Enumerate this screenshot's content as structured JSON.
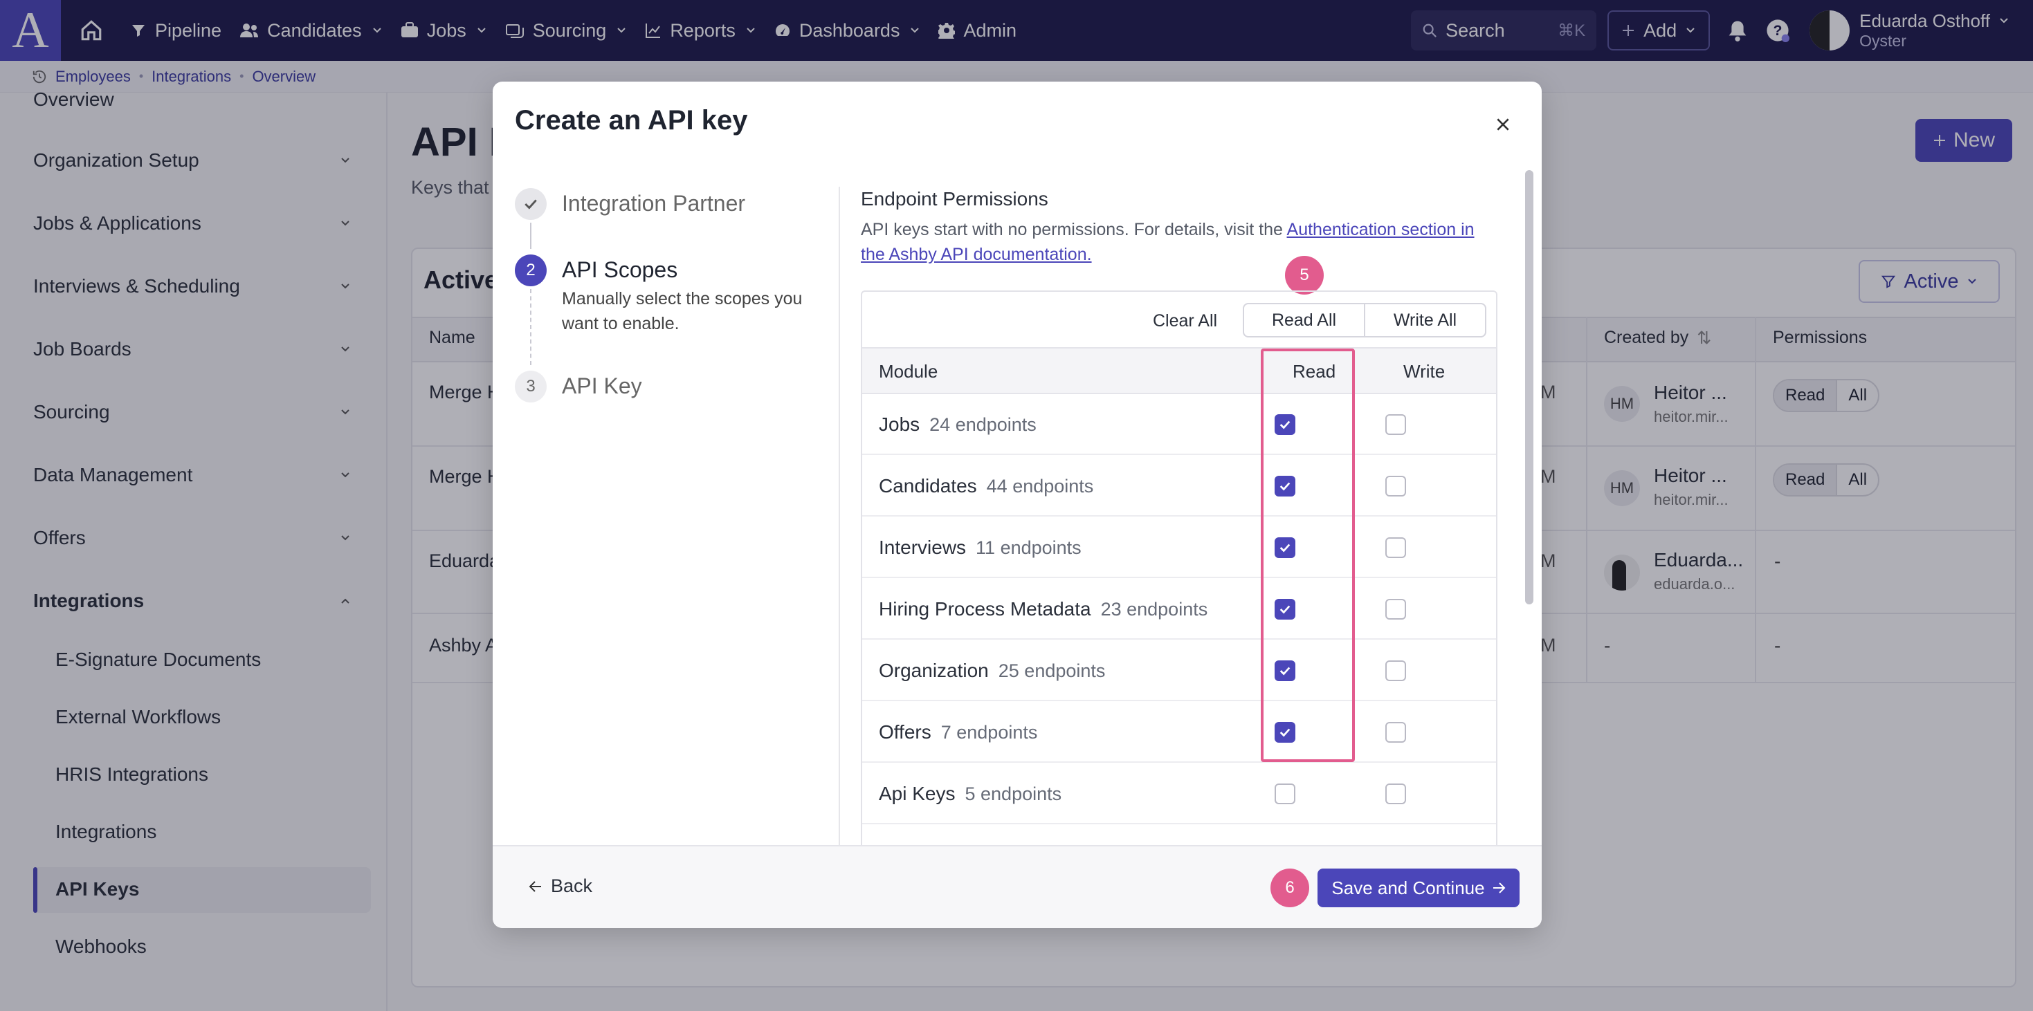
{
  "nav": {
    "logo": "A",
    "items": [
      {
        "label": "Pipeline",
        "icon": "filter-icon",
        "dropdown": false
      },
      {
        "label": "Candidates",
        "icon": "people-icon",
        "dropdown": true
      },
      {
        "label": "Jobs",
        "icon": "briefcase-icon",
        "dropdown": true
      },
      {
        "label": "Sourcing",
        "icon": "sourcing-icon",
        "dropdown": true
      },
      {
        "label": "Reports",
        "icon": "chart-icon",
        "dropdown": true
      },
      {
        "label": "Dashboards",
        "icon": "gauge-icon",
        "dropdown": true
      },
      {
        "label": "Admin",
        "icon": "gear-icon",
        "dropdown": false
      }
    ],
    "search_label": "Search",
    "search_shortcut": "⌘K",
    "add_label": "Add",
    "user_name": "Eduarda Osthoff",
    "user_org": "Oyster"
  },
  "breadcrumb": [
    "Employees",
    "Integrations",
    "Overview"
  ],
  "sidebar": {
    "overview": "Overview",
    "sections": [
      "Organization Setup",
      "Jobs & Applications",
      "Interviews & Scheduling",
      "Job Boards",
      "Sourcing",
      "Data Management",
      "Offers"
    ],
    "expanded": "Integrations",
    "sub_items": [
      "E-Signature Documents",
      "External Workflows",
      "HRIS Integrations",
      "Integrations",
      "API Keys",
      "Webhooks"
    ],
    "active_item": "API Keys"
  },
  "page": {
    "title": "API K",
    "description": "Keys that",
    "new_label": "New",
    "card_title": "Active",
    "filter_label": "Active",
    "columns": {
      "name": "Name",
      "created_by": "Created by",
      "permissions": "Permissions"
    },
    "rows": [
      {
        "name": "Merge H",
        "m": "M",
        "creator": "Heitor ...",
        "email": "heitor.mir...",
        "initials": "HM",
        "perm_a": "Read",
        "perm_b": "All"
      },
      {
        "name": "Merge H",
        "m": "M",
        "creator": "Heitor ...",
        "email": "heitor.mir...",
        "initials": "HM",
        "perm_a": "Read",
        "perm_b": "All"
      },
      {
        "name": "Eduarda",
        "m": "M",
        "creator": "Eduarda...",
        "email": "eduarda.o...",
        "dash": "-"
      },
      {
        "name": "Ashby A",
        "m": "M",
        "dash1": "-",
        "dash2": "-"
      }
    ]
  },
  "modal": {
    "title": "Create an API key",
    "steps": [
      {
        "num": "1",
        "label": "Integration Partner",
        "state": "done"
      },
      {
        "num": "2",
        "label": "API Scopes",
        "state": "current",
        "desc": "Manually select the scopes you want to enable."
      },
      {
        "num": "3",
        "label": "API Key",
        "state": "todo"
      }
    ],
    "section_title": "Endpoint Permissions",
    "section_desc": "API keys start with no permissions. For details, visit the ",
    "section_link": "Authentication section in the Ashby API documentation.",
    "clear_all": "Clear All",
    "read_all": "Read All",
    "write_all": "Write All",
    "col_module": "Module",
    "col_read": "Read",
    "col_write": "Write",
    "modules": [
      {
        "name": "Jobs",
        "count": "24 endpoints",
        "read": true,
        "write": false
      },
      {
        "name": "Candidates",
        "count": "44 endpoints",
        "read": true,
        "write": false
      },
      {
        "name": "Interviews",
        "count": "11 endpoints",
        "read": true,
        "write": false
      },
      {
        "name": "Hiring Process Metadata",
        "count": "23 endpoints",
        "read": true,
        "write": false
      },
      {
        "name": "Organization",
        "count": "25 endpoints",
        "read": true,
        "write": false
      },
      {
        "name": "Offers",
        "count": "7 endpoints",
        "read": true,
        "write": false
      },
      {
        "name": "Api Keys",
        "count": "5 endpoints",
        "read": false,
        "write": false
      }
    ],
    "badge_read": "5",
    "badge_save": "6",
    "back_label": "Back",
    "save_label": "Save and Continue",
    "accent": "#4b46b9",
    "highlight_color": "#e25c8e"
  }
}
